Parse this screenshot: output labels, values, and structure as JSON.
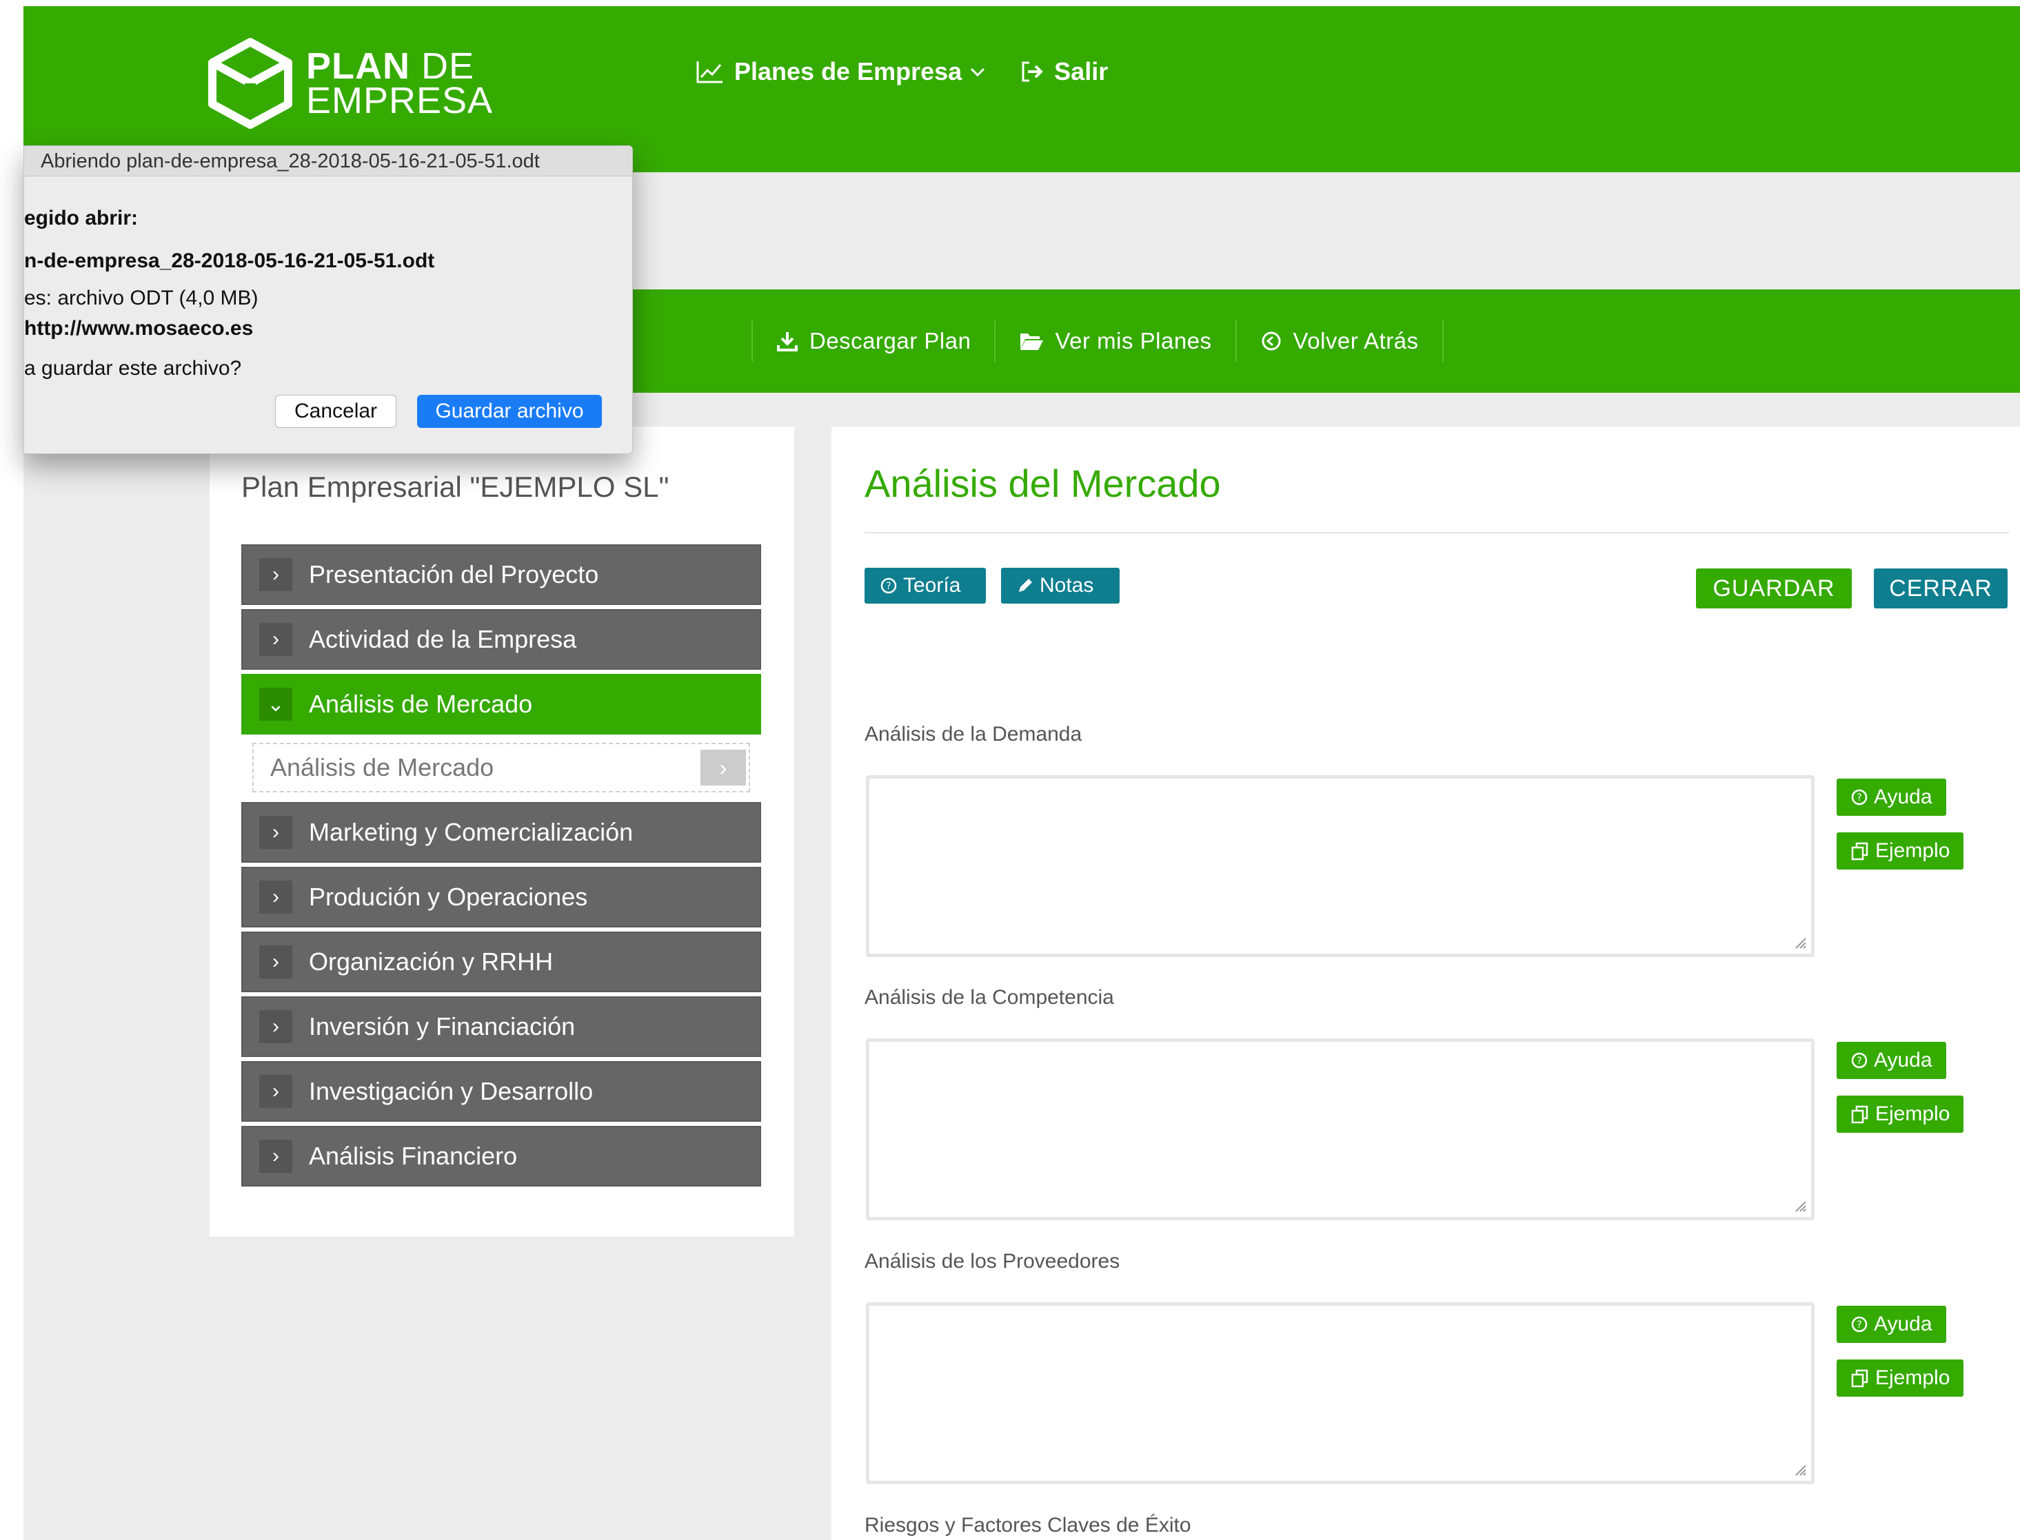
{
  "logo": {
    "line1_bold": "PLAN",
    "line1_thin": "DE",
    "line2": "EMPRESA"
  },
  "topnav": {
    "plans": "Planes de Empresa",
    "logout": "Salir"
  },
  "actions": [
    {
      "label": "Descargar Plan",
      "icon": "download-icon"
    },
    {
      "label": "Ver mis Planes",
      "icon": "folder-open-icon"
    },
    {
      "label": "Volver Atrás",
      "icon": "back-circle-icon"
    }
  ],
  "sidebar": {
    "plan_title": "Plan Empresarial \"EJEMPLO SL\"",
    "items": [
      {
        "label": "Presentación del Proyecto"
      },
      {
        "label": "Actividad de la Empresa"
      },
      {
        "label": "Análisis de Mercado",
        "active": true
      },
      {
        "label": "Marketing y Comercialización"
      },
      {
        "label": "Produción y Operaciones"
      },
      {
        "label": "Organización y RRHH"
      },
      {
        "label": "Inversión y Financiación"
      },
      {
        "label": "Investigación y Desarrollo"
      },
      {
        "label": "Análisis Financiero"
      }
    ],
    "subitem": "Análisis de Mercado"
  },
  "main": {
    "title": "Análisis del Mercado",
    "theory": "Teoría",
    "notes": "Notas",
    "save": "GUARDAR",
    "close": "CERRAR",
    "help": "Ayuda",
    "example": "Ejemplo",
    "fields": [
      {
        "label": "Análisis de la Demanda",
        "value": ""
      },
      {
        "label": "Análisis de la Competencia",
        "value": ""
      },
      {
        "label": "Análisis de los Proveedores",
        "value": ""
      },
      {
        "label": "Riesgos y Factores Claves de Éxito",
        "value": ""
      }
    ]
  },
  "dialog": {
    "title": "Abriendo plan-de-empresa_28-2018-05-16-21-05-51.odt",
    "chosen": "egido abrir:",
    "filename": "n-de-empresa_28-2018-05-16-21-05-51.odt",
    "type": "es: archivo ODT (4,0 MB)",
    "from": "http://www.mosaeco.es",
    "question": "a guardar este archivo?",
    "cancel": "Cancelar",
    "save_file": "Guardar archivo"
  },
  "colors": {
    "brand_green": "#35aa00",
    "teal": "#0f7e8f",
    "menu_gray": "#666666",
    "dialog_blue": "#1a7cf5"
  }
}
